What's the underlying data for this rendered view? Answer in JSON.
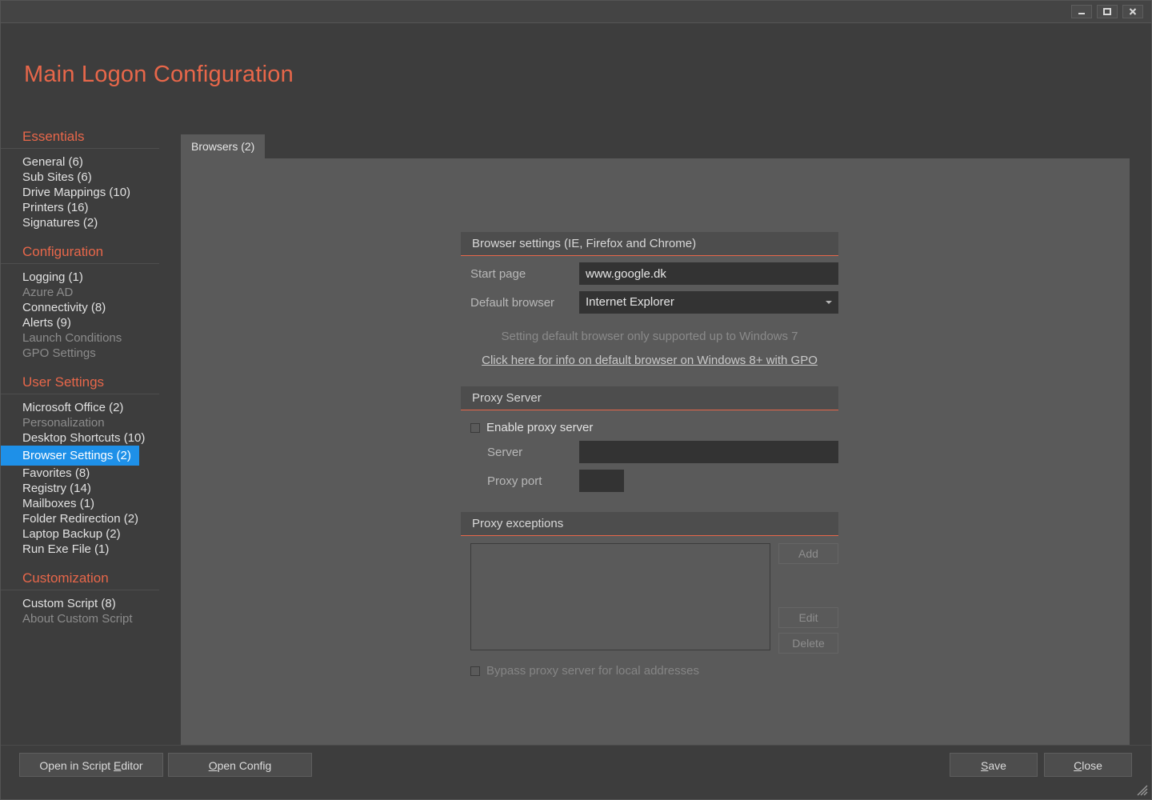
{
  "window": {
    "controls": [
      {
        "name": "minimize",
        "glyph": "—"
      },
      {
        "name": "maximize",
        "glyph": "□"
      },
      {
        "name": "close",
        "glyph": "✕"
      }
    ]
  },
  "app": {
    "title": "Main Logon Configuration",
    "accent_color": "#e8674a",
    "selection_color": "#1e90e8",
    "background_color": "#3d3d3d",
    "panel_color": "#5a5a5a",
    "input_color": "#333333"
  },
  "sidebar": {
    "groups": [
      {
        "heading": "Essentials",
        "items": [
          {
            "label": "General (6)",
            "state": "normal"
          },
          {
            "label": "Sub Sites (6)",
            "state": "normal"
          },
          {
            "label": "Drive Mappings (10)",
            "state": "normal"
          },
          {
            "label": "Printers (16)",
            "state": "normal"
          },
          {
            "label": "Signatures (2)",
            "state": "normal"
          }
        ]
      },
      {
        "heading": "Configuration",
        "items": [
          {
            "label": "Logging (1)",
            "state": "normal"
          },
          {
            "label": "Azure AD",
            "state": "disabled"
          },
          {
            "label": "Connectivity (8)",
            "state": "normal"
          },
          {
            "label": "Alerts (9)",
            "state": "normal"
          },
          {
            "label": "Launch Conditions",
            "state": "disabled"
          },
          {
            "label": "GPO Settings",
            "state": "disabled"
          }
        ]
      },
      {
        "heading": "User Settings",
        "items": [
          {
            "label": "Microsoft Office (2)",
            "state": "normal"
          },
          {
            "label": "Personalization",
            "state": "disabled"
          },
          {
            "label": "Desktop Shortcuts (10)",
            "state": "normal"
          },
          {
            "label": "Browser Settings (2)",
            "state": "selected"
          },
          {
            "label": "Favorites (8)",
            "state": "normal"
          },
          {
            "label": "Registry (14)",
            "state": "normal"
          },
          {
            "label": "Mailboxes (1)",
            "state": "normal"
          },
          {
            "label": "Folder Redirection (2)",
            "state": "normal"
          },
          {
            "label": "Laptop Backup (2)",
            "state": "normal"
          },
          {
            "label": "Run Exe File (1)",
            "state": "normal"
          }
        ]
      },
      {
        "heading": "Customization",
        "items": [
          {
            "label": "Custom Script (8)",
            "state": "normal"
          },
          {
            "label": "About Custom Script",
            "state": "disabled"
          }
        ]
      }
    ]
  },
  "tabs": [
    {
      "label": "Browsers (2)",
      "active": true
    }
  ],
  "browser_settings": {
    "header": "Browser settings (IE, Firefox and Chrome)",
    "start_page_label": "Start page",
    "start_page_value": "www.google.dk",
    "default_browser_label": "Default browser",
    "default_browser_value": "Internet Explorer",
    "note": "Setting default browser only supported up to Windows 7",
    "link": "Click here for info on default browser on Windows 8+ with GPO"
  },
  "proxy_server": {
    "header": "Proxy Server",
    "enable_label": "Enable proxy server",
    "enable_checked": false,
    "server_label": "Server",
    "server_value": "",
    "port_label": "Proxy port",
    "port_value": ""
  },
  "proxy_exceptions": {
    "header": "Proxy exceptions",
    "items": [],
    "add_label": "Add",
    "edit_label": "Edit",
    "delete_label": "Delete",
    "bypass_label": "Bypass proxy server for local addresses",
    "bypass_checked": false
  },
  "footer": {
    "script_editor_label": "Open in Script Editor",
    "script_editor_mnemonic": "E",
    "open_config_label": "Open Config",
    "open_config_mnemonic": "O",
    "save_label": "Save",
    "save_mnemonic": "S",
    "close_label": "Close",
    "close_mnemonic": "C"
  }
}
